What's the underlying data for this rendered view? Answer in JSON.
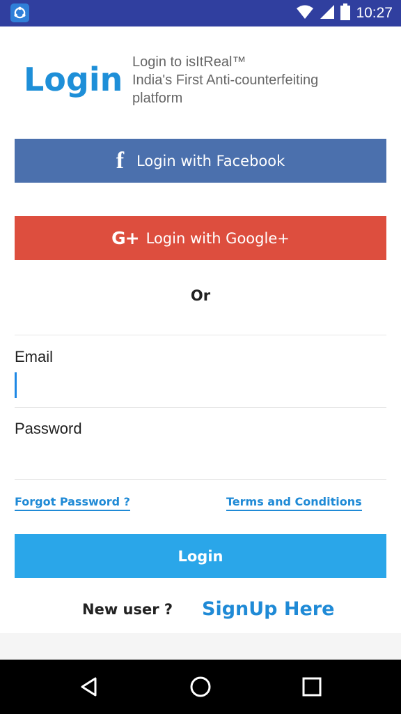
{
  "status_bar": {
    "time": "10:27",
    "icons": [
      "app-notification-icon",
      "wifi-icon",
      "signal-icon",
      "battery-icon"
    ]
  },
  "header": {
    "logo_text": "Login",
    "tagline_lines": [
      "Login to isItReal™",
      "India's First Anti-counterfeiting",
      "platform"
    ]
  },
  "social": {
    "facebook_label": "Login with Facebook",
    "facebook_icon_glyph": "f",
    "google_label": "Login with Google+",
    "google_icon_glyph": "G+",
    "or_text": "Or"
  },
  "form": {
    "email_label": "Email",
    "email_value": "",
    "password_label": "Password",
    "password_value": ""
  },
  "links": {
    "forgot_password": "Forgot Password ?",
    "terms": "Terms and Conditions"
  },
  "actions": {
    "login_button": "Login",
    "new_user_text": "New user ?",
    "signup_link": "SignUp Here"
  },
  "colors": {
    "brand_blue": "#1e8fd8",
    "facebook": "#4b70ad",
    "google": "#dd4e3e",
    "login_button": "#2aa6e9",
    "status_bar": "#303f9f"
  },
  "nav": {
    "icons": [
      "back-icon",
      "home-icon",
      "recents-icon"
    ]
  }
}
